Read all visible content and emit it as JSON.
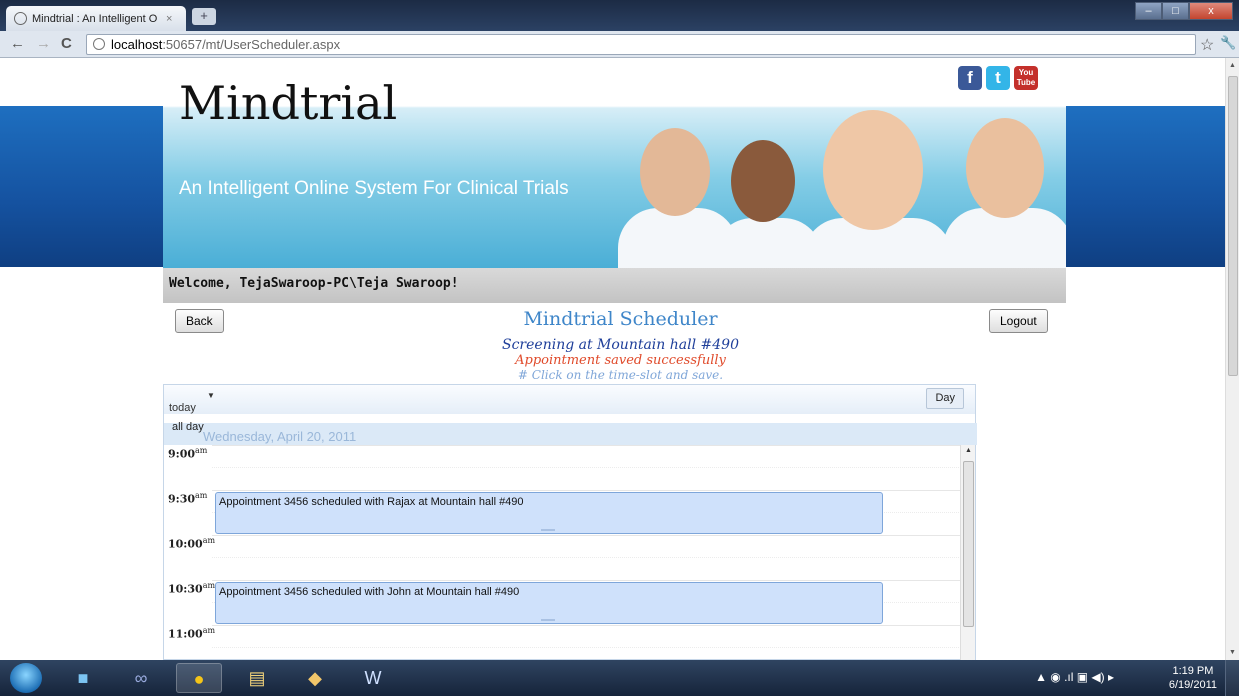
{
  "browser": {
    "tab_title": "Mindtrial : An Intelligent O",
    "tab_close": "×",
    "new_tab": "+",
    "url_host": "localhost",
    "url_path": ":50657/mt/UserScheduler.aspx",
    "back_icon": "←",
    "forward_icon": "→",
    "reload_icon": "C",
    "star_icon": "☆",
    "wrench_icon": "🔧",
    "minimize": "–",
    "maximize": "□",
    "close": "x"
  },
  "header": {
    "logo": "Mindtrial",
    "tagline": "An Intelligent Online System For Clinical Trials",
    "social": {
      "facebook": "f",
      "twitter": "t",
      "youtube_top": "You",
      "youtube_bottom": "Tube"
    }
  },
  "welcome": "Welcome, TejaSwaroop-PC\\Teja Swaroop!",
  "buttons": {
    "back": "Back",
    "logout": "Logout"
  },
  "scheduler": {
    "title": "Mindtrial Scheduler",
    "subtitle": "Screening at Mountain hall #490",
    "status": "Appointment saved successfully",
    "hint": "# Click on the time-slot and save."
  },
  "calendar": {
    "today": "today",
    "view_day": "Day",
    "all_day": "all day",
    "date": "Wednesday, April 20, 2011",
    "times": [
      {
        "hour": "9:00",
        "suffix": "am"
      },
      {
        "hour": "9:30",
        "suffix": "am"
      },
      {
        "hour": "10:00",
        "suffix": "am"
      },
      {
        "hour": "10:30",
        "suffix": "am"
      },
      {
        "hour": "11:00",
        "suffix": "am"
      }
    ],
    "events": [
      "Appointment 3456 scheduled with Rajax at Mountain hall #490",
      "Appointment 3456 scheduled with John at Mountain hall #490"
    ]
  },
  "taskbar": {
    "clock_time": "1:19 PM",
    "clock_date": "6/19/2011",
    "tray_icons": "▲ ◉ .ıl ▣ ◀) ▸"
  },
  "colors": {
    "brand_blue": "#1552a0",
    "title_blue": "#3f86c9",
    "subtitle_blue": "#1f3f9a",
    "status_red": "#e04a2a",
    "hint_blue": "#7fa6d8",
    "event_fill": "#cfe1fb"
  }
}
